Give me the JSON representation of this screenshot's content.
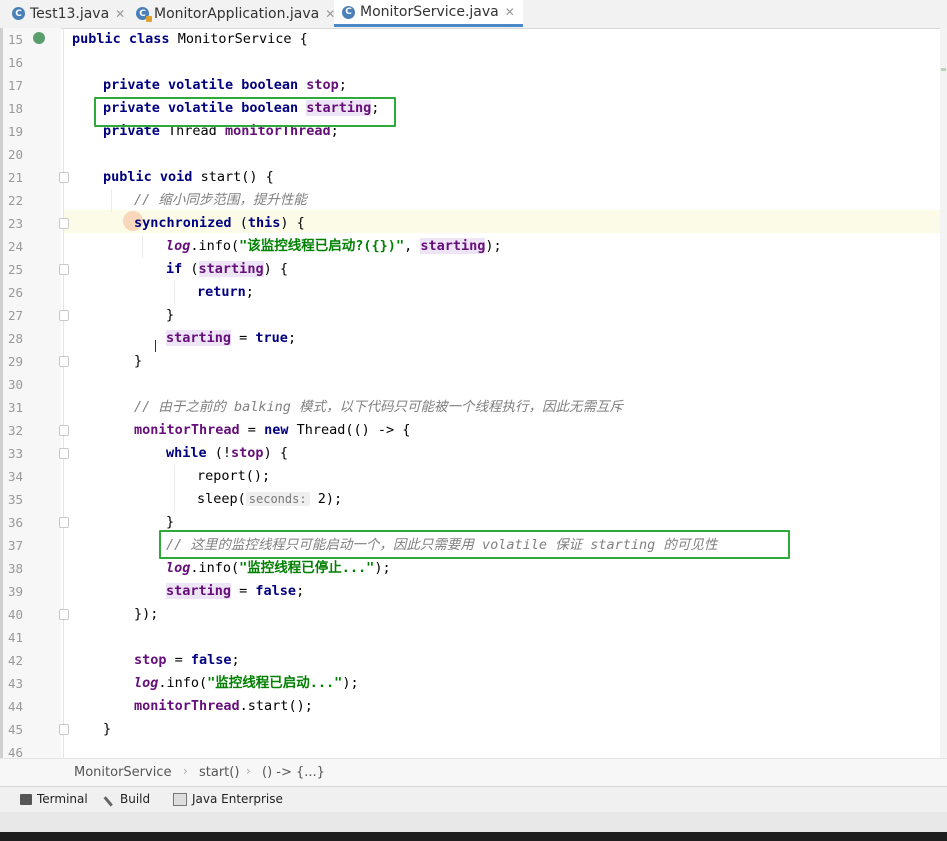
{
  "tabs": [
    {
      "label": "Test13.java",
      "icon": "class-c-icon"
    },
    {
      "label": "MonitorApplication.java",
      "icon": "class-c-icon"
    },
    {
      "label": "MonitorService.java",
      "icon": "class-c-icon"
    }
  ],
  "lines": {
    "n15": "15",
    "n16": "16",
    "n17": "17",
    "n18": "18",
    "n19": "19",
    "n20": "20",
    "n21": "21",
    "n22": "22",
    "n23": "23",
    "n24": "24",
    "n25": "25",
    "n26": "26",
    "n27": "27",
    "n28": "28",
    "n29": "29",
    "n30": "30",
    "n31": "31",
    "n32": "32",
    "n33": "33",
    "n34": "34",
    "n35": "35",
    "n36": "36",
    "n37": "37",
    "n38": "38",
    "n39": "39",
    "n40": "40",
    "n41": "41",
    "n42": "42",
    "n43": "43",
    "n44": "44",
    "n45": "45",
    "n46": "46"
  },
  "code": {
    "public": "public",
    "class": "class",
    "class_name": "MonitorService {",
    "private": "private",
    "volatile": "volatile",
    "boolean": "boolean",
    "stop": "stop",
    "starting": "starting",
    "semicolon": ";",
    "thread_type": "Thread",
    "monitorThread": "monitorThread",
    "void": "void",
    "start_sig": "start() {",
    "comment22": "// 缩小同步范围，提升性能",
    "synchronized": "synchronized",
    "sync_open": "(",
    "this": "this",
    "sync_close": ") {",
    "log": "log",
    "info_open": ".info(",
    "str24": "\"该监控线程已启动?({})\"",
    "comma": ", ",
    "close_paren_semi": ");",
    "if": "if",
    "paren_open": "(",
    "paren_close_brace": ") {",
    "return": "return",
    "brace_close": "}",
    "assign": " = ",
    "true": "true",
    "comment31": "// 由于之前的 balking 模式，以下代码只可能被一个线程执行，因此无需互斥",
    "new": "new",
    "thread_lambda": "Thread(() -> {",
    "while": "while",
    "while_cond_open": "(!",
    "report": "report();",
    "sleep_open": "sleep(",
    "sleep_hint": "seconds:",
    "sleep_arg": "2);",
    "comment37": "// 这里的监控线程只可能启动一个，因此只需要用 volatile 保证 starting 的可见性",
    "str38": "\"监控线程已停止...\"",
    "false": "false",
    "close_lambda": "});",
    "str43": "\"监控线程已启动...\"",
    "monitor_start": ".start();"
  },
  "breadcrumb": [
    "MonitorService",
    "start()",
    "() -> {...}"
  ],
  "toolbar": {
    "terminal": "Terminal",
    "build": "Build",
    "java_ee": "Java Enterprise"
  },
  "colors": {
    "keyword": "#000080",
    "field": "#660e7a",
    "string": "#008000",
    "comment": "#808080",
    "annotation_box": "#2eaa3a"
  }
}
